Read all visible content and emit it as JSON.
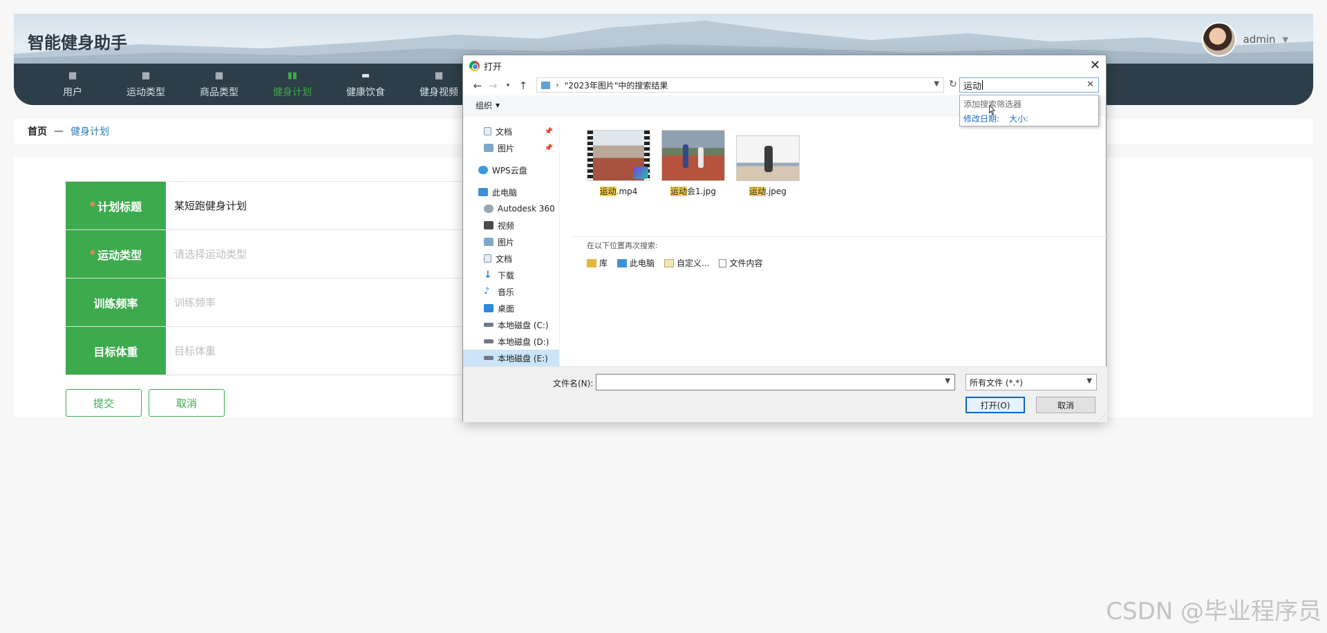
{
  "app": {
    "title": "智能健身助手",
    "username": "admin"
  },
  "nav": {
    "items": [
      {
        "label": "用户",
        "icon": "grid-icon"
      },
      {
        "label": "运动类型",
        "icon": "grid-icon"
      },
      {
        "label": "商品类型",
        "icon": "grid-icon"
      },
      {
        "label": "健身计划",
        "icon": "bar-chart-icon",
        "active": true
      },
      {
        "label": "健康饮食",
        "icon": "chat-icon"
      },
      {
        "label": "健身视频",
        "icon": "grid-icon"
      }
    ]
  },
  "breadcrumb": {
    "home": "首页",
    "sep": "—",
    "current": "健身计划"
  },
  "form": {
    "rows": [
      {
        "label": "计划标题",
        "required": "*",
        "value": "某短跑健身计划"
      },
      {
        "label": "运动类型",
        "required": "*",
        "placeholder": "请选择运动类型"
      },
      {
        "label": "训练频率",
        "placeholder": "训练频率"
      },
      {
        "label": "目标体重",
        "placeholder": "目标体重"
      }
    ],
    "submit_label": "提交",
    "cancel_label": "取消"
  },
  "dialog": {
    "title": "打开",
    "close": "✕",
    "address": "\"2023年图片\"中的搜索结果",
    "search_text": "运动",
    "search_popup": {
      "title": "添加搜索筛选器",
      "filters": [
        "修改日期:",
        "大小:"
      ]
    },
    "toolbar": {
      "organize": "组织"
    },
    "nav_pane": [
      {
        "label": "文档",
        "icon": "document-icon",
        "pinned": true
      },
      {
        "label": "图片",
        "icon": "pictures-icon",
        "pinned": true
      },
      {
        "label": "WPS云盘",
        "icon": "cloud-icon"
      },
      {
        "label": "此电脑",
        "icon": "computer-icon"
      },
      {
        "label": "Autodesk 360",
        "icon": "autodesk-icon"
      },
      {
        "label": "视频",
        "icon": "video-icon"
      },
      {
        "label": "图片",
        "icon": "pictures-icon"
      },
      {
        "label": "文档",
        "icon": "document-icon"
      },
      {
        "label": "下载",
        "icon": "download-icon"
      },
      {
        "label": "音乐",
        "icon": "music-icon"
      },
      {
        "label": "桌面",
        "icon": "desktop-icon"
      },
      {
        "label": "本地磁盘 (C:)",
        "icon": "drive-icon"
      },
      {
        "label": "本地磁盘 (D:)",
        "icon": "drive-icon"
      },
      {
        "label": "本地磁盘 (E:)",
        "icon": "drive-icon",
        "selected": true
      }
    ],
    "files": [
      {
        "highlight": "运动",
        "rest": ".mp4"
      },
      {
        "highlight": "运动",
        "rest": "会1.jpg"
      },
      {
        "highlight": "运动",
        "rest": ".jpeg"
      }
    ],
    "search_again": {
      "title": "在以下位置再次搜索:",
      "locations": [
        "库",
        "此电脑",
        "自定义...",
        "文件内容"
      ]
    },
    "footer": {
      "filename_label": "文件名(N):",
      "filename_value": "",
      "filetype": "所有文件 (*.*)",
      "open_label": "打开(O)",
      "cancel_label": "取消"
    }
  },
  "watermark": "CSDN @毕业程序员",
  "colors": {
    "primary_green": "#3daa4e",
    "nav_bg": "#2d3e48",
    "link_blue": "#2a7ab0",
    "highlight": "#f6d24d"
  }
}
